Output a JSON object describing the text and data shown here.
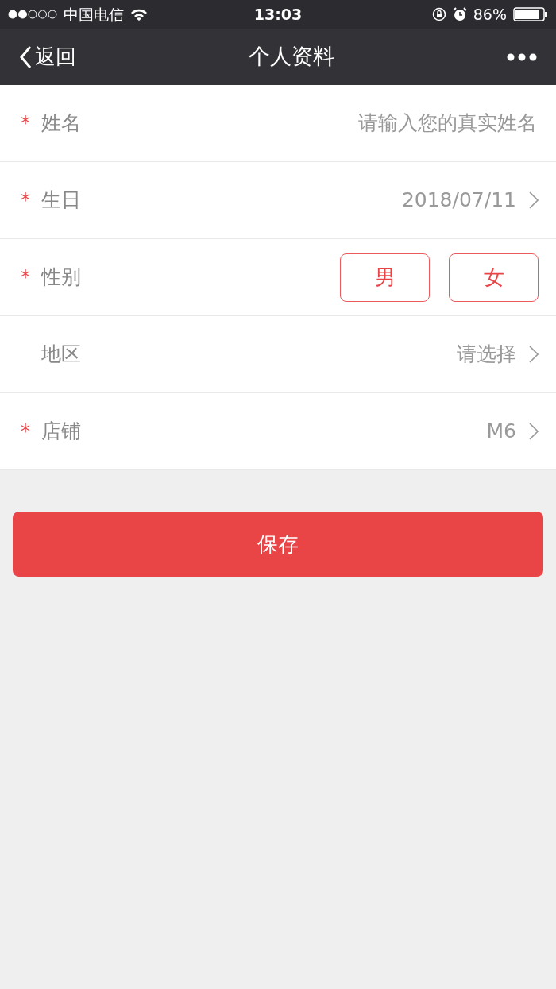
{
  "status_bar": {
    "carrier": "中国电信",
    "time": "13:03",
    "battery": "86%"
  },
  "nav": {
    "back": "返回",
    "title": "个人资料"
  },
  "fields": [
    {
      "kind": "input",
      "label": "姓名",
      "required_mark": "*",
      "placeholder": "请输入您的真实姓名"
    },
    {
      "kind": "select",
      "label": "生日",
      "required_mark": "*",
      "value": "2018/07/11"
    },
    {
      "kind": "gender",
      "label": "性别",
      "required_mark": "*",
      "options": [
        {
          "label": "男",
          "selected": false
        },
        {
          "label": "女",
          "selected": false
        }
      ]
    },
    {
      "kind": "select",
      "label": "地区",
      "value": "请选择"
    },
    {
      "kind": "select",
      "label": "店铺",
      "required_mark": "*",
      "value": "M6"
    }
  ],
  "save_button": "保存"
}
